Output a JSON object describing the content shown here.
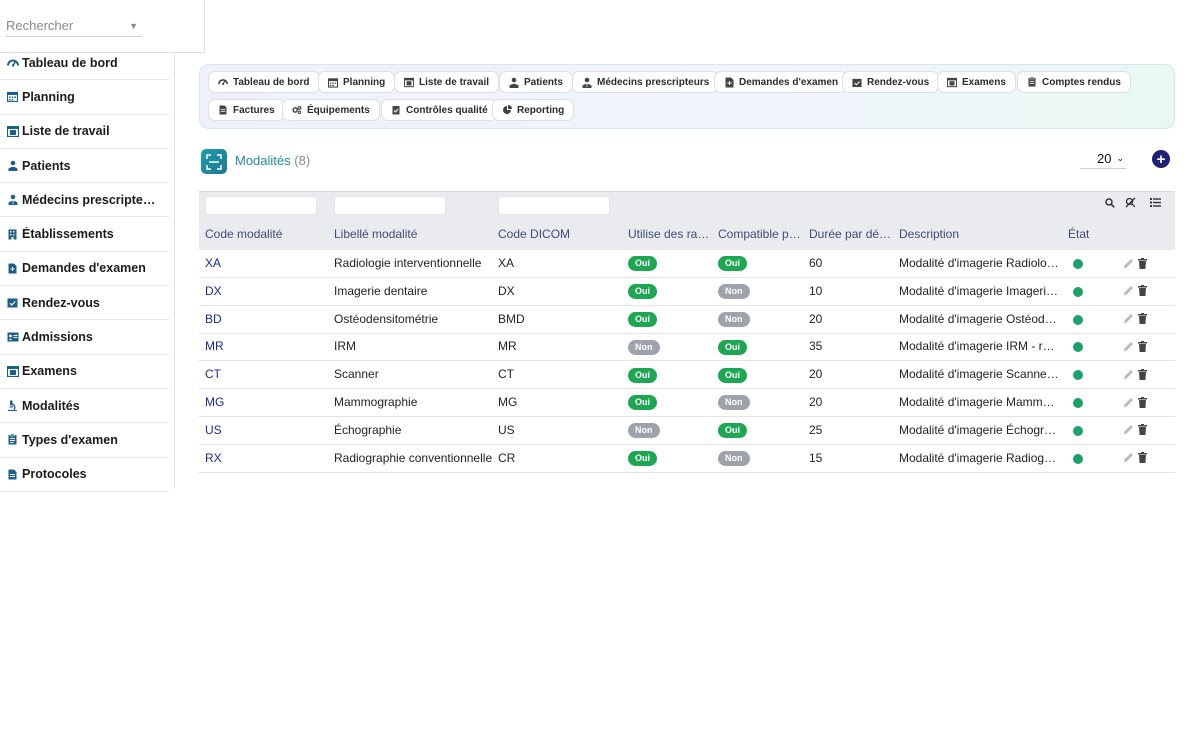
{
  "search": {
    "placeholder": "Rechercher"
  },
  "sidebar": {
    "items": [
      {
        "label": "Tableau de bord",
        "icon": "dashboard-icon"
      },
      {
        "label": "Planning",
        "icon": "calendar-icon"
      },
      {
        "label": "Liste de travail",
        "icon": "worklist-icon"
      },
      {
        "label": "Patients",
        "icon": "patient-icon"
      },
      {
        "label": "Médecins prescripte…",
        "icon": "doctor-icon"
      },
      {
        "label": "Établissements",
        "icon": "building-icon"
      },
      {
        "label": "Demandes d'examen",
        "icon": "request-icon"
      },
      {
        "label": "Rendez-vous",
        "icon": "appointment-icon"
      },
      {
        "label": "Admissions",
        "icon": "admission-icon"
      },
      {
        "label": "Examens",
        "icon": "exam-icon"
      },
      {
        "label": "Modalités",
        "icon": "microscope-icon"
      },
      {
        "label": "Types d'examen",
        "icon": "clipboard-icon"
      },
      {
        "label": "Protocoles",
        "icon": "protocol-icon"
      }
    ]
  },
  "quicknav": {
    "row1": [
      "Tableau de bord",
      "Planning",
      "Liste de travail",
      "Patients",
      "Médecins prescripteurs",
      "Demandes d'examen",
      "Rendez-vous",
      "Examens",
      "Comptes rendus"
    ],
    "row2": [
      "Factures",
      "Équipements",
      "Contrôles qualité",
      "Reporting"
    ]
  },
  "page": {
    "title": "Modalités",
    "count": "(8)",
    "page_size": "20"
  },
  "table": {
    "columns": [
      "Code modalité",
      "Libellé modalité",
      "Code DICOM",
      "Utilise des ra…",
      "Compatible p…",
      "Durée par dé…",
      "Description",
      "État"
    ],
    "rows": [
      {
        "code": "XA",
        "label": "Radiologie interventionnelle",
        "dicom": "XA",
        "uses": "Oui",
        "compat": "Oui",
        "duration": "60",
        "desc": "Modalité d'imagerie Radiologi…"
      },
      {
        "code": "DX",
        "label": "Imagerie dentaire",
        "dicom": "DX",
        "uses": "Oui",
        "compat": "Non",
        "duration": "10",
        "desc": "Modalité d'imagerie Imagerie …"
      },
      {
        "code": "BD",
        "label": "Ostéodensitométrie",
        "dicom": "BMD",
        "uses": "Oui",
        "compat": "Non",
        "duration": "20",
        "desc": "Modalité d'imagerie Ostéode…"
      },
      {
        "code": "MR",
        "label": "IRM",
        "dicom": "MR",
        "uses": "Non",
        "compat": "Oui",
        "duration": "35",
        "desc": "Modalité d'imagerie IRM - réf…"
      },
      {
        "code": "CT",
        "label": "Scanner",
        "dicom": "CT",
        "uses": "Oui",
        "compat": "Oui",
        "duration": "20",
        "desc": "Modalité d'imagerie Scanner …"
      },
      {
        "code": "MG",
        "label": "Mammographie",
        "dicom": "MG",
        "uses": "Oui",
        "compat": "Non",
        "duration": "20",
        "desc": "Modalité d'imagerie Mammog…"
      },
      {
        "code": "US",
        "label": "Échographie",
        "dicom": "US",
        "uses": "Non",
        "compat": "Oui",
        "duration": "25",
        "desc": "Modalité d'imagerie Échogra…"
      },
      {
        "code": "RX",
        "label": "Radiographie conventionnelle",
        "dicom": "CR",
        "uses": "Oui",
        "compat": "Non",
        "duration": "15",
        "desc": "Modalité d'imagerie Radiogra…"
      }
    ]
  },
  "colors": {
    "accent": "#1f8aa0",
    "navy": "#1e2270",
    "yes": "#1fa653",
    "no": "#9ea3ab",
    "status_active": "#1fa06a"
  }
}
